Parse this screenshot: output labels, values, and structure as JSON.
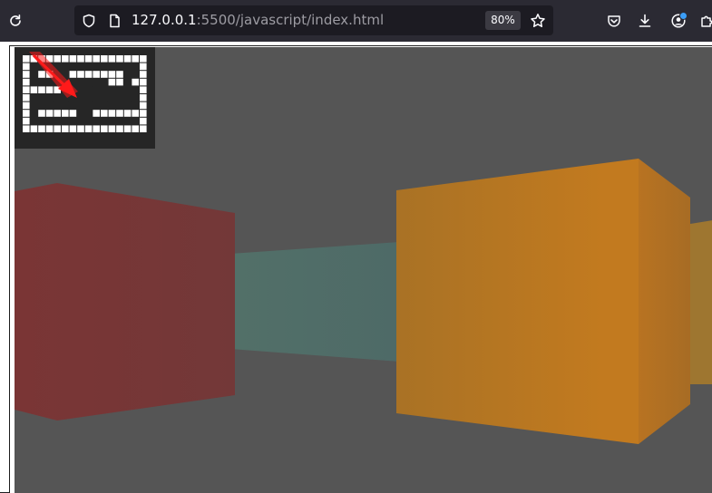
{
  "browser": {
    "url_host": "127.0.0.1",
    "url_path": ":5500/javascript/index.html",
    "zoom": "80%"
  },
  "icons": {
    "reload": "reload-icon",
    "shield": "tracking-protection-shield-icon",
    "page": "page-info-icon",
    "star": "bookmark-star-icon",
    "pocket": "pocket-icon",
    "download": "download-arrow-icon",
    "account": "account-avatar-icon",
    "extensions": "extensions-puzzle-icon"
  },
  "scene": {
    "sky_color": "#555555",
    "floor_color": "#555555",
    "wall_colors": [
      "#7a3535",
      "#4f6c68",
      "#c07a23",
      "#a0782e"
    ]
  },
  "minimap": {
    "grid": [
      "1111111111111111",
      "1000000000000001",
      "1011001111111001",
      "1000000000011011",
      "1111100000000001",
      "1000000000000001",
      "1000000000000001",
      "1011111001111111",
      "1000000000000001",
      "1111111111111111"
    ],
    "player_arrow_color": "#ff1a1a"
  }
}
